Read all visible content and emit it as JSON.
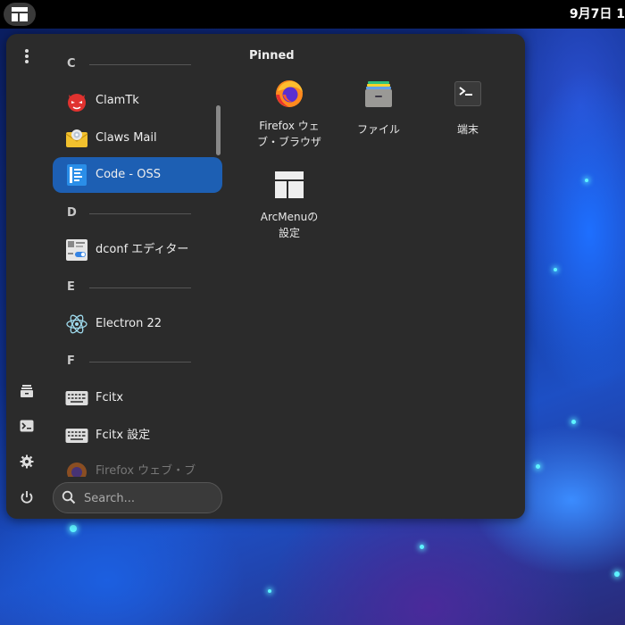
{
  "topbar": {
    "clock": "9月7日 1"
  },
  "sidebar": {
    "categories": [
      "C",
      "D",
      "E",
      "F"
    ],
    "apps": [
      {
        "label": "ClamTk",
        "icon": "clamtk-icon"
      },
      {
        "label": "Claws Mail",
        "icon": "claws-mail-icon"
      },
      {
        "label": "Code - OSS",
        "icon": "code-oss-icon",
        "selected": true
      },
      {
        "label": "dconf エディター",
        "icon": "dconf-editor-icon"
      },
      {
        "label": "Electron 22",
        "icon": "electron-icon"
      },
      {
        "label": "Fcitx",
        "icon": "keyboard-icon"
      },
      {
        "label": "Fcitx 設定",
        "icon": "keyboard-icon"
      },
      {
        "label": "Firefox ウェブ・ブ",
        "icon": "firefox-icon"
      }
    ]
  },
  "search": {
    "placeholder": "Search..."
  },
  "pinned": {
    "title": "Pinned",
    "items": [
      {
        "label": "Firefox ウェ\nブ・ブラウザ",
        "icon": "firefox-icon"
      },
      {
        "label": "ファイル",
        "icon": "files-icon"
      },
      {
        "label": "端末",
        "icon": "terminal-icon"
      },
      {
        "label": "ArcMenuの\n設定",
        "icon": "arcmenu-settings-icon"
      }
    ]
  },
  "colors": {
    "accent": "#1d5fb3",
    "menu_bg": "#2b2b2b"
  }
}
